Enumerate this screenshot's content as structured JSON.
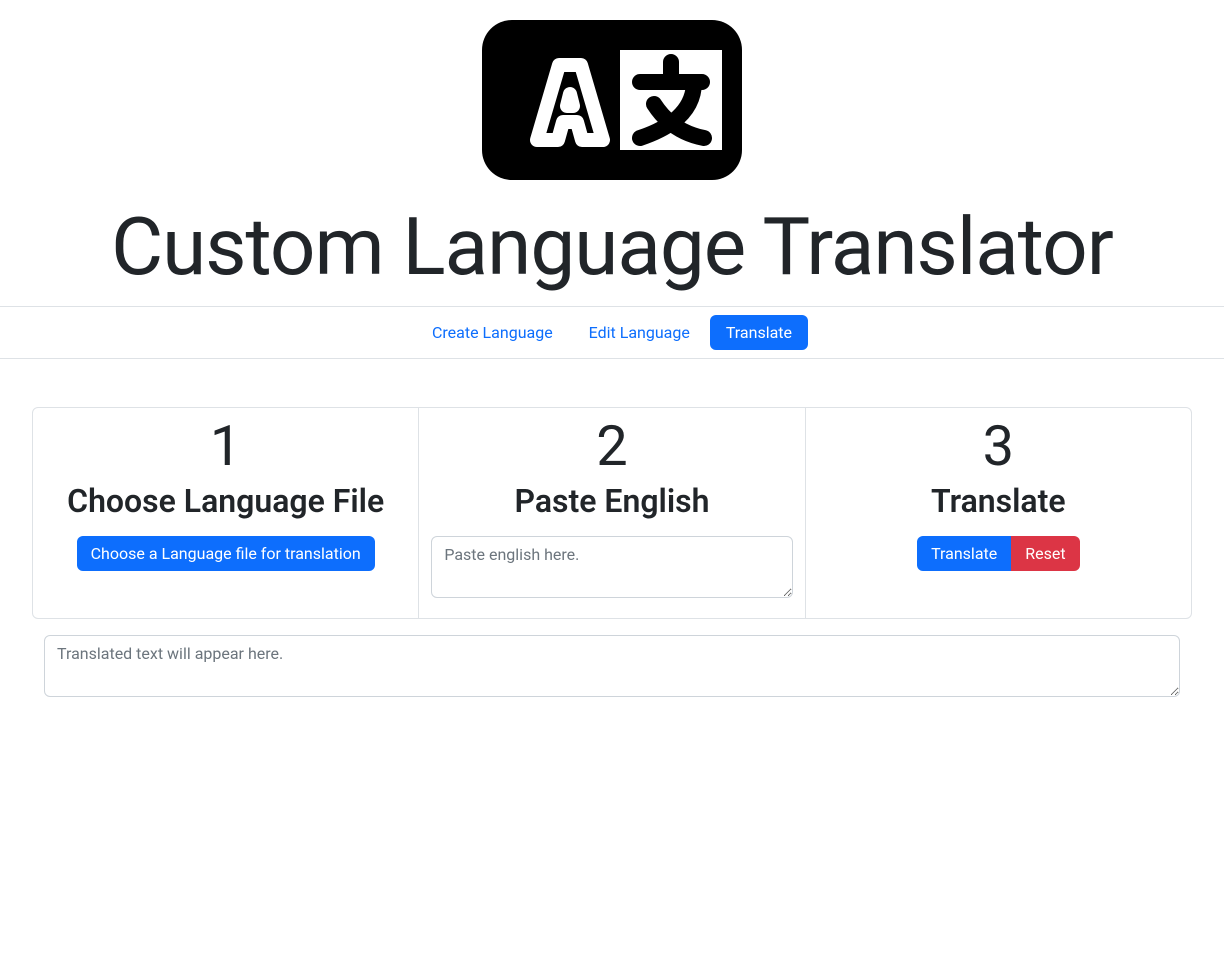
{
  "header": {
    "title": "Custom Language Translator"
  },
  "nav": {
    "items": [
      {
        "label": "Create Language",
        "active": false
      },
      {
        "label": "Edit Language",
        "active": false
      },
      {
        "label": "Translate",
        "active": true
      }
    ]
  },
  "steps": {
    "step1": {
      "number": "1",
      "title": "Choose Language File",
      "button_label": "Choose a Language file for translation"
    },
    "step2": {
      "number": "2",
      "title": "Paste English",
      "placeholder": "Paste english here."
    },
    "step3": {
      "number": "3",
      "title": "Translate",
      "translate_label": "Translate",
      "reset_label": "Reset"
    }
  },
  "output": {
    "placeholder": "Translated text will appear here."
  }
}
